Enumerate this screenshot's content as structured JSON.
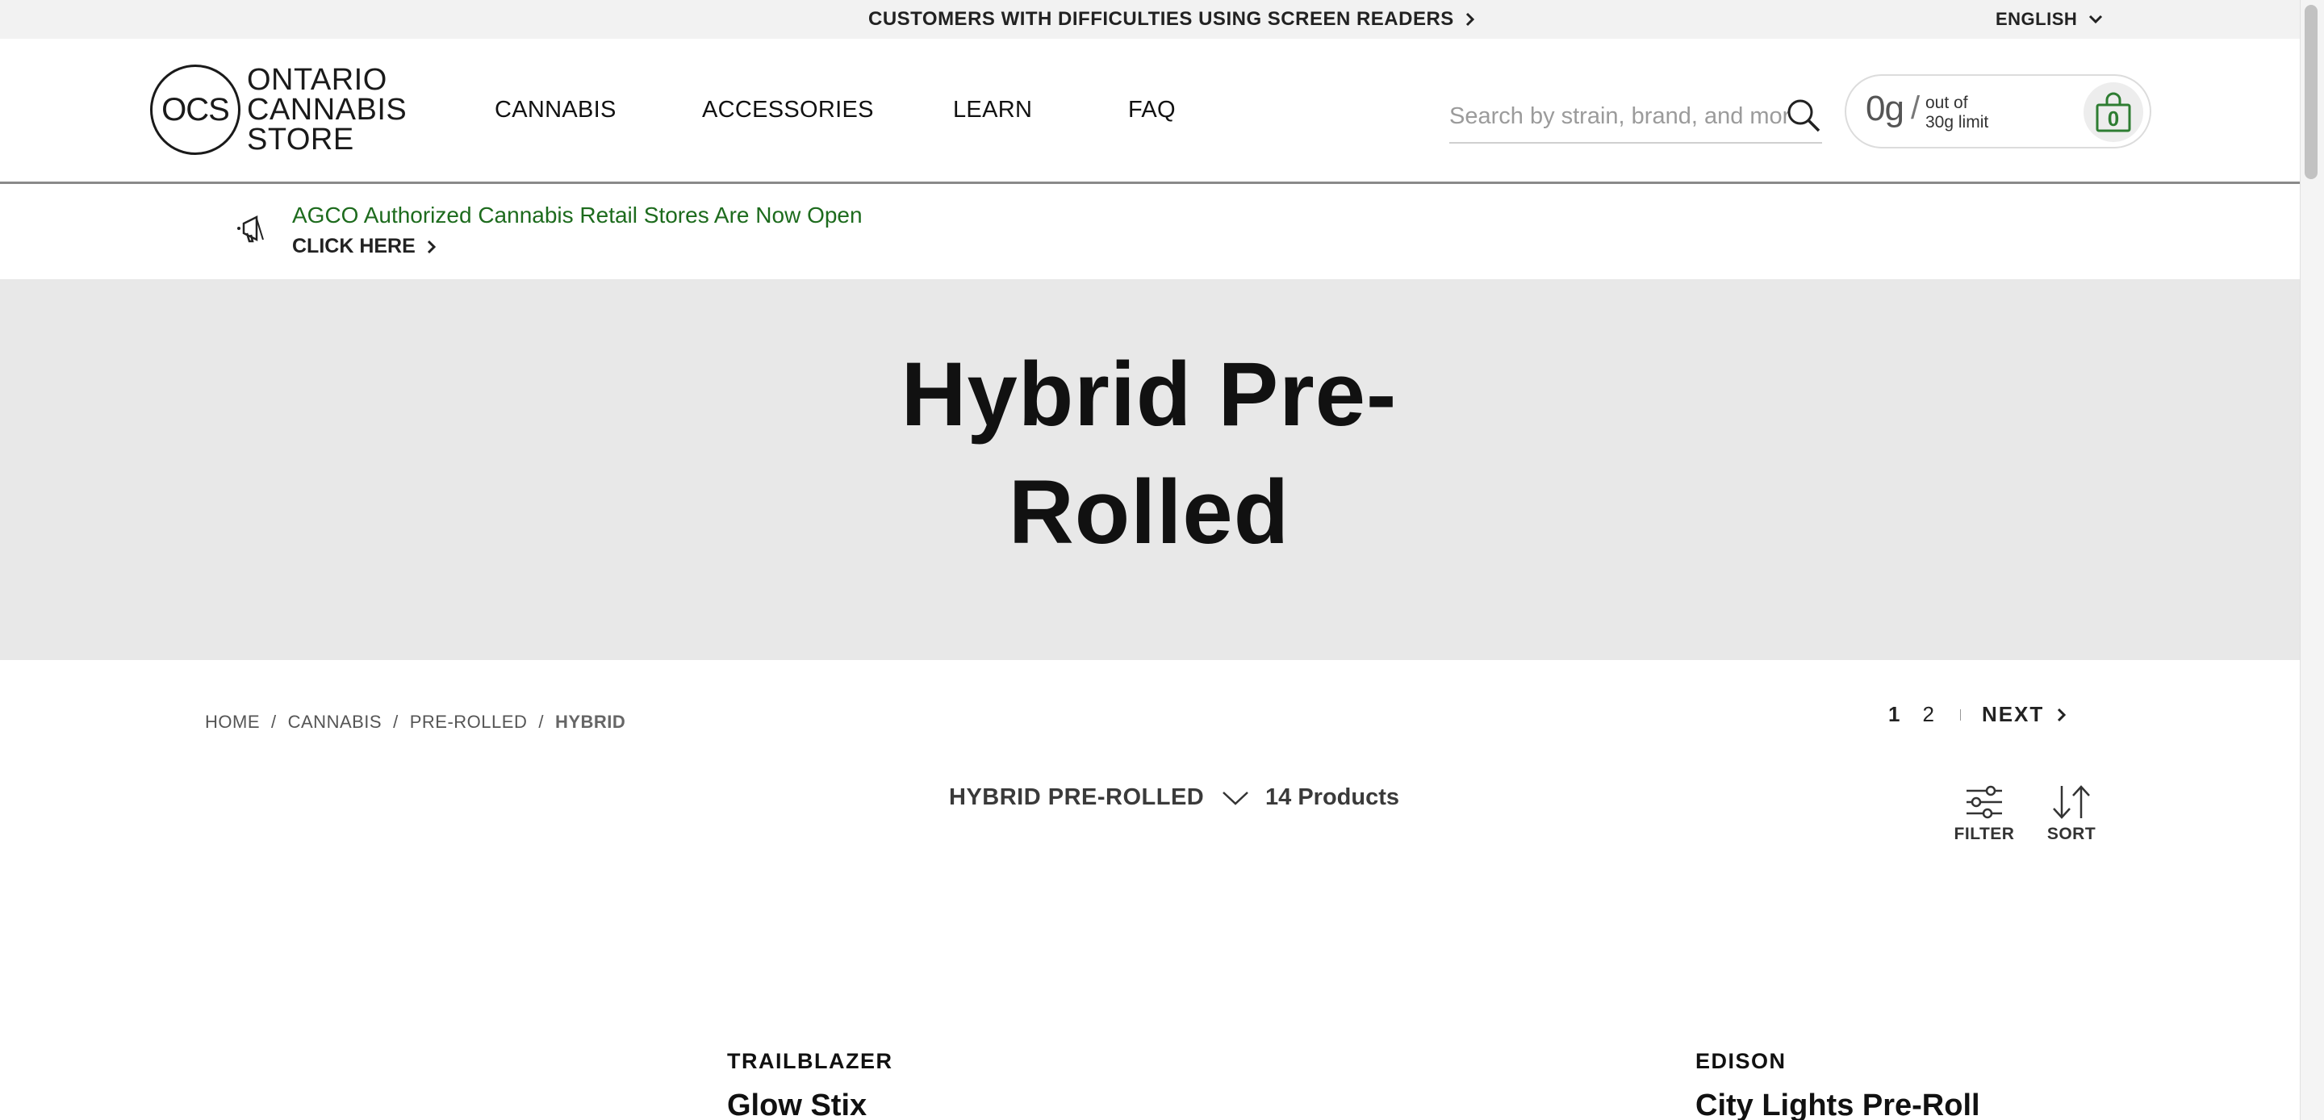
{
  "topbar": {
    "a11y_link": "CUSTOMERS WITH DIFFICULTIES USING SCREEN READERS",
    "language": "ENGLISH"
  },
  "logo": {
    "mark": "OCS",
    "line1": "ONTARIO",
    "line2": "CANNABIS",
    "line3": "STORE"
  },
  "nav": {
    "items": [
      {
        "label": "CANNABIS"
      },
      {
        "label": "ACCESSORIES"
      },
      {
        "label": "LEARN"
      },
      {
        "label": "FAQ"
      }
    ]
  },
  "search": {
    "placeholder": "Search by strain, brand, and more",
    "value": ""
  },
  "limit": {
    "grams": "0g",
    "slash": "/",
    "out_of": "out of",
    "limit_text": "30g limit",
    "cart_count": "0"
  },
  "announcement": {
    "message": "AGCO Authorized Cannabis Retail Stores Are Now Open",
    "cta": "CLICK HERE"
  },
  "hero": {
    "title_line1": "Hybrid Pre-",
    "title_line2": "Rolled"
  },
  "breadcrumb": {
    "items": [
      "HOME",
      "CANNABIS",
      "PRE-ROLLED"
    ],
    "current": "HYBRID",
    "separator": "/"
  },
  "pagination": {
    "current_page": "1",
    "page2": "2",
    "next": "NEXT"
  },
  "toolbar": {
    "category": "HYBRID PRE-ROLLED",
    "product_count": "14 Products",
    "filter": "FILTER",
    "sort": "SORT"
  },
  "products": [
    {
      "brand": "TRAILBLAZER",
      "name": "Glow Stix"
    },
    {
      "brand": "EDISON",
      "name": "City Lights Pre-Roll"
    }
  ],
  "colors": {
    "announcement_text": "#1d6b1d",
    "cart_count": "#2e7d32",
    "hero_bg": "#e8e8e8",
    "topbar_bg": "#f2f2f2"
  },
  "icons": {
    "a11y_chevron": "chevron-right-icon",
    "language_chevron": "chevron-down-icon",
    "search": "search-icon",
    "bag": "shopping-bag-icon",
    "megaphone": "megaphone-icon",
    "filter": "filter-sliders-icon",
    "sort": "sort-arrows-icon"
  }
}
